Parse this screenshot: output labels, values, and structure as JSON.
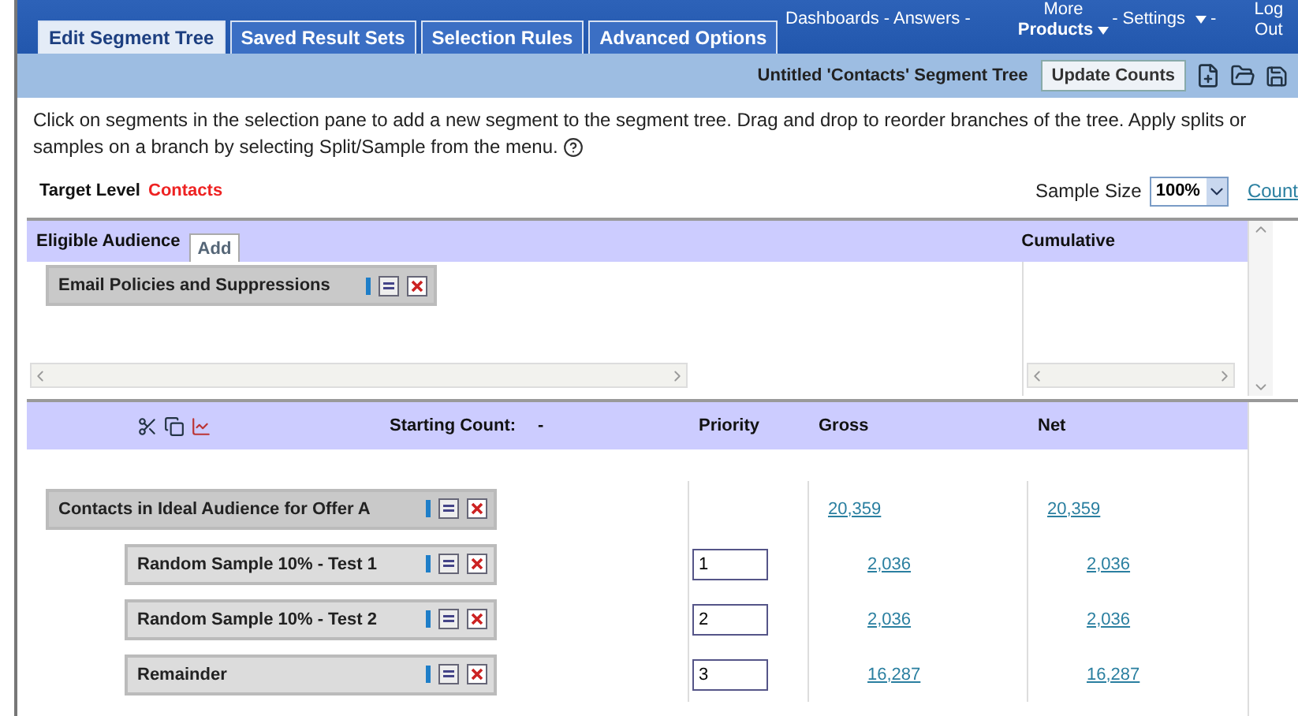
{
  "tabs": [
    {
      "label": "Edit Segment Tree",
      "selected": true
    },
    {
      "label": "Saved Result Sets",
      "selected": false
    },
    {
      "label": "Selection Rules",
      "selected": false
    },
    {
      "label": "Advanced Options",
      "selected": false
    }
  ],
  "top_menu": {
    "links": [
      "Dashboards - Answers -"
    ],
    "more_top": "More",
    "more": "Products",
    "settings": "- Settings",
    "tail": "-",
    "logout_top": "Log",
    "logout": "Out"
  },
  "toolbar": {
    "title": "Untitled 'Contacts' Segment Tree",
    "button": "Update Counts"
  },
  "instructions": "Click on segments in the selection pane to add a new segment to the segment tree. Drag and drop to reorder branches of the tree. Apply splits or samples on a branch by selecting Split/Sample from the menu.",
  "target": {
    "label": "Target Level",
    "value": "Contacts",
    "sample_label": "Sample Size",
    "sample_value": "100%",
    "link": "Count"
  },
  "eligible": {
    "title": "Eligible Audience",
    "add": "Add",
    "cumulative": "Cumulative",
    "segments": [
      "Email Policies and Suppressions"
    ]
  },
  "tree": {
    "starting_label": "Starting Count:",
    "starting_value": "-",
    "columns": [
      "Priority",
      "Gross",
      "Net"
    ],
    "segments": [
      {
        "name": "Contacts in Ideal Audience for Offer A",
        "gross": "20,359",
        "net": "20,359",
        "children": [
          {
            "name": "Random Sample 10% - Test 1",
            "priority": "1",
            "gross": "2,036",
            "net": "2,036"
          },
          {
            "name": "Random Sample 10% - Test 2",
            "priority": "2",
            "gross": "2,036",
            "net": "2,036"
          },
          {
            "name": "Remainder",
            "priority": "3",
            "gross": "16,287",
            "net": "16,287"
          }
        ]
      }
    ]
  }
}
